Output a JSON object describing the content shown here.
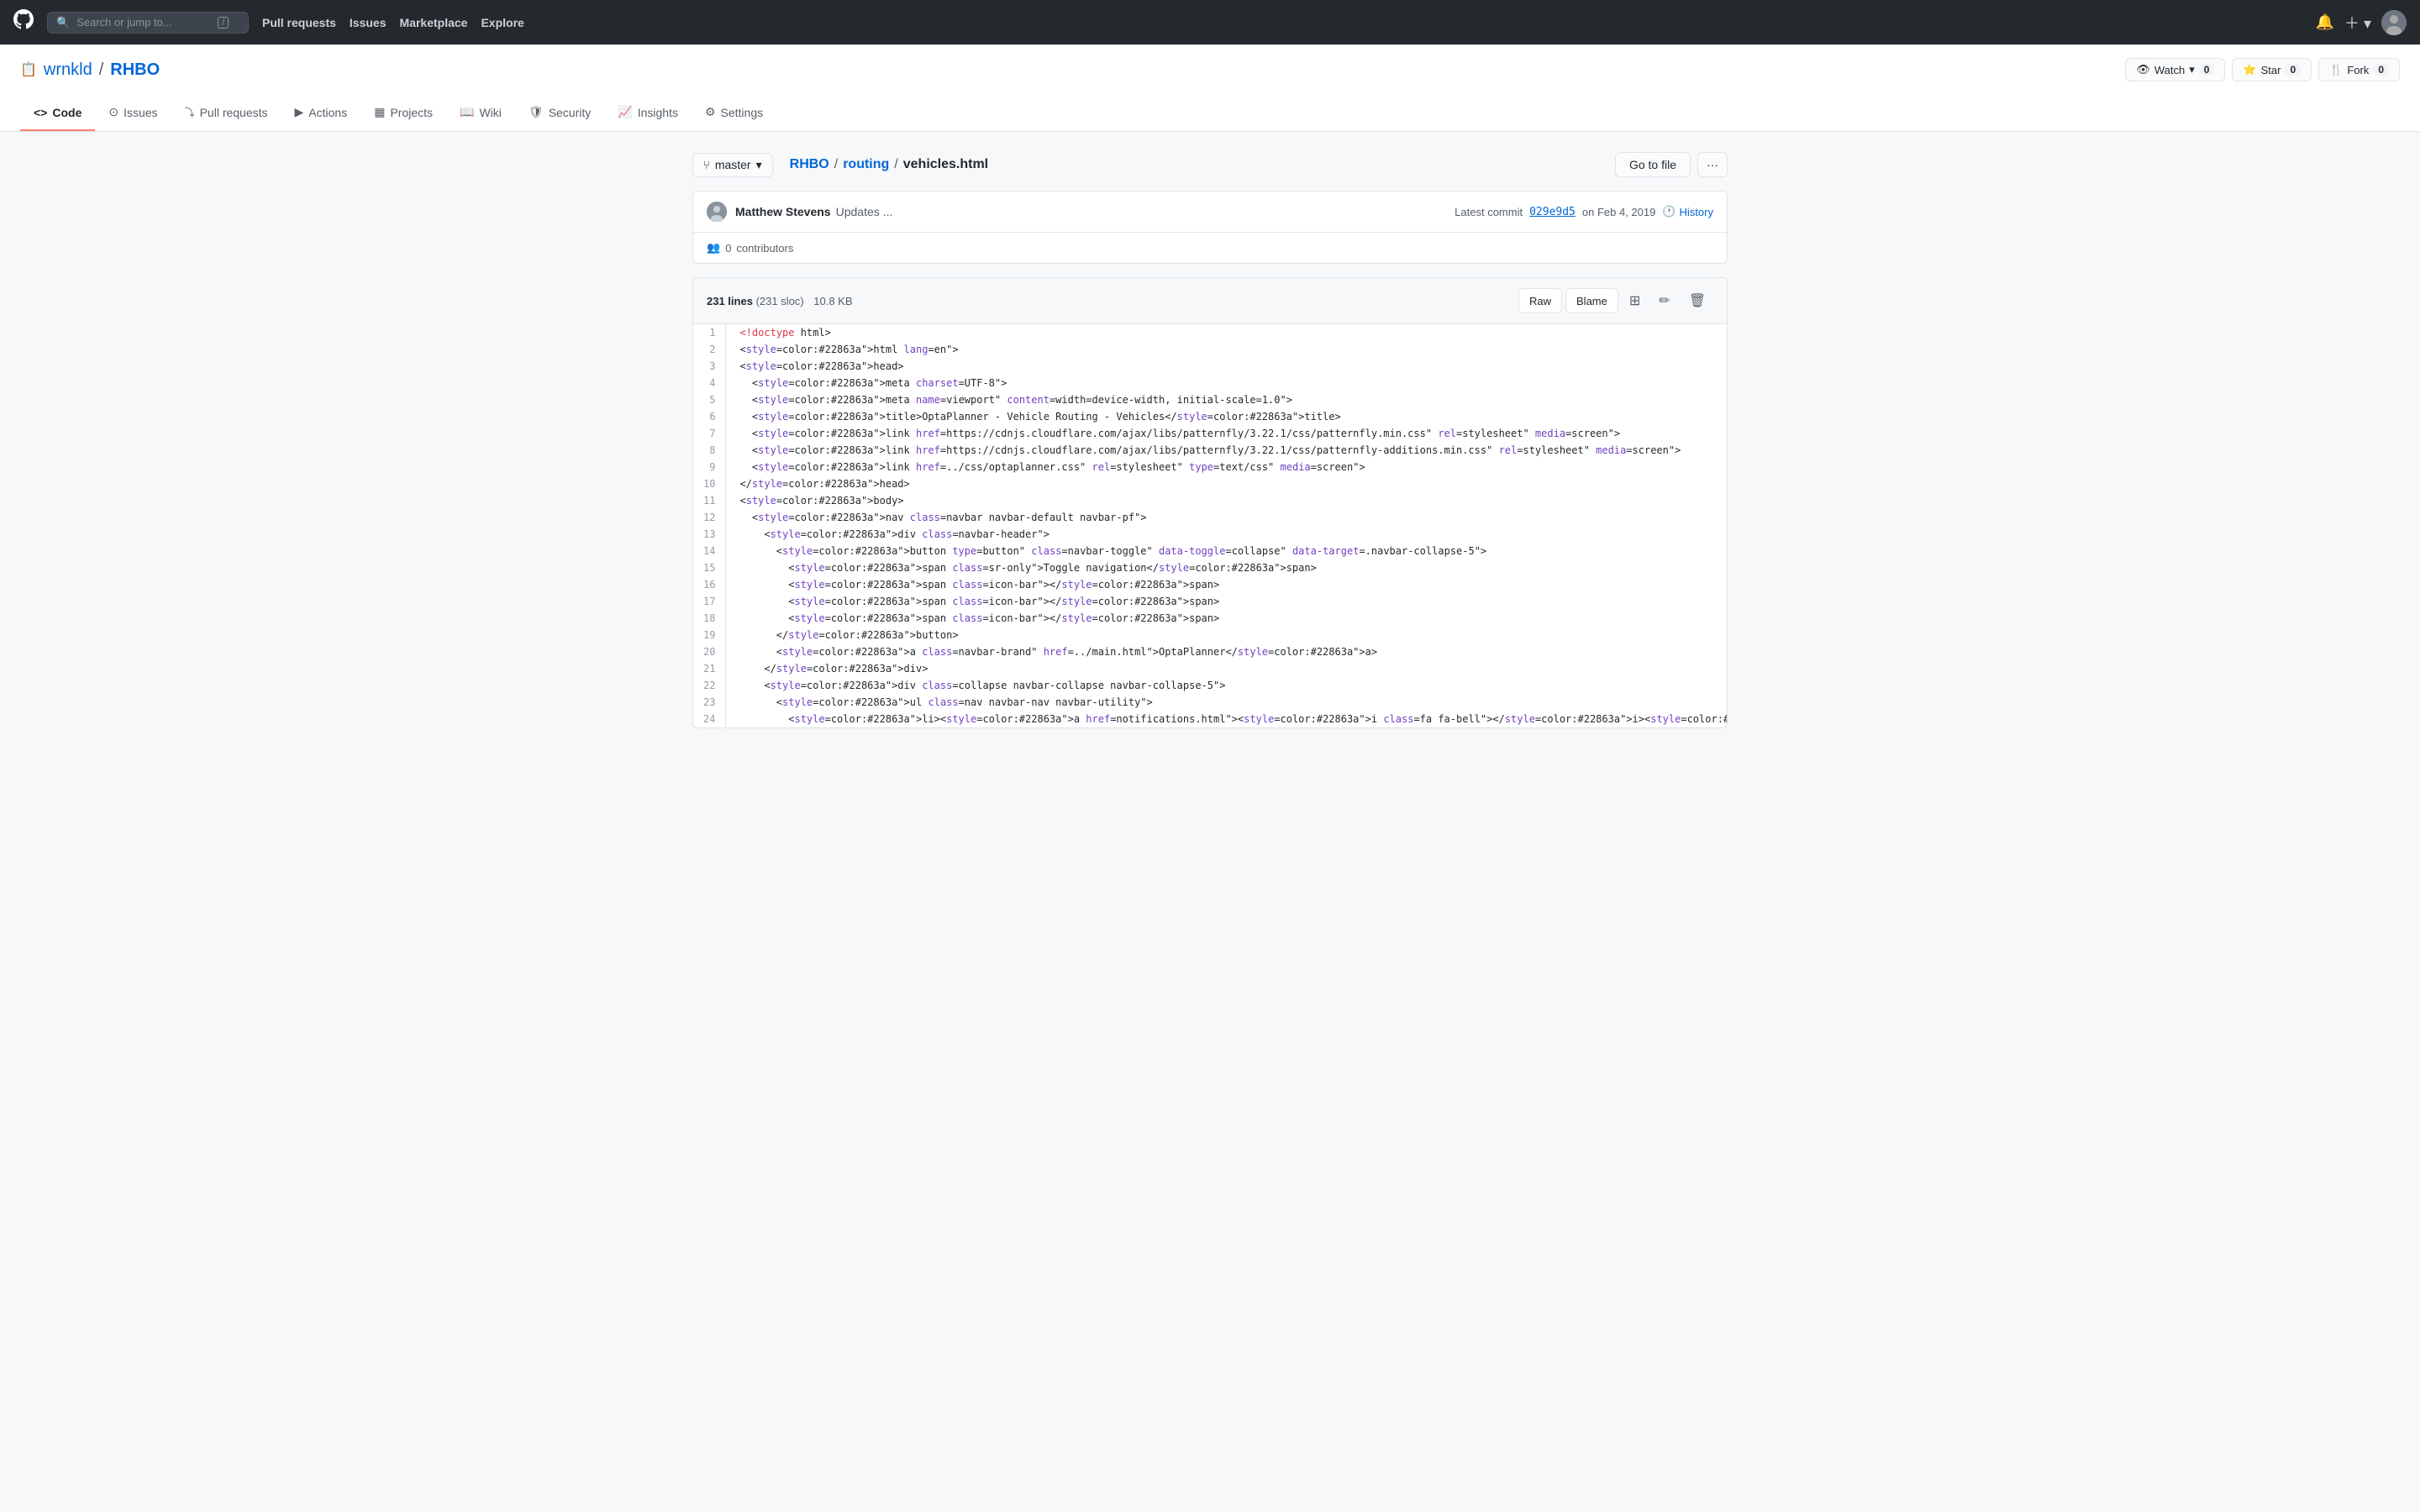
{
  "topnav": {
    "search_placeholder": "Search or jump to...",
    "slash_shortcut": "/",
    "links": [
      "Pull requests",
      "Issues",
      "Marketplace",
      "Explore"
    ],
    "watch_label": "Watch",
    "watch_count": "0",
    "star_label": "Star",
    "star_count": "0",
    "fork_label": "Fork",
    "fork_count": "0"
  },
  "repo": {
    "owner": "wrnkld",
    "name": "RHBO",
    "tabs": [
      {
        "label": "Code",
        "icon": "code"
      },
      {
        "label": "Issues",
        "icon": "issue"
      },
      {
        "label": "Pull requests",
        "icon": "pr"
      },
      {
        "label": "Actions",
        "icon": "action"
      },
      {
        "label": "Projects",
        "icon": "project"
      },
      {
        "label": "Wiki",
        "icon": "wiki"
      },
      {
        "label": "Security",
        "icon": "shield"
      },
      {
        "label": "Insights",
        "icon": "chart"
      },
      {
        "label": "Settings",
        "icon": "gear"
      }
    ],
    "active_tab": "Code"
  },
  "breadcrumb": {
    "branch": "master",
    "parts": [
      "RHBO",
      "routing"
    ],
    "file": "vehicles.html"
  },
  "commit": {
    "author_name": "Matthew Stevens",
    "message": "Updates",
    "dots": "...",
    "latest_commit_label": "Latest commit",
    "hash": "029e9d5",
    "date": "on Feb 4, 2019",
    "history_label": "History"
  },
  "contributors": {
    "icon": "👥",
    "count": "0",
    "label": "contributors"
  },
  "file_viewer": {
    "lines_label": "231 lines",
    "sloc_label": "(231 sloc)",
    "size": "10.8 KB",
    "raw_label": "Raw",
    "blame_label": "Blame"
  },
  "code_lines": [
    {
      "num": 1,
      "content": "<!doctype html>"
    },
    {
      "num": 2,
      "content": "<html lang=\"en\">"
    },
    {
      "num": 3,
      "content": "<head>"
    },
    {
      "num": 4,
      "content": "  <meta charset=\"UTF-8\">"
    },
    {
      "num": 5,
      "content": "  <meta name=\"viewport\" content=\"width=device-width, initial-scale=1.0\">"
    },
    {
      "num": 6,
      "content": "  <title>OptaPlanner - Vehicle Routing - Vehicles</title>"
    },
    {
      "num": 7,
      "content": "  <link href=\"https://cdnjs.cloudflare.com/ajax/libs/patternfly/3.22.1/css/patternfly.min.css\" rel=\"stylesheet\" media=\"screen\">"
    },
    {
      "num": 8,
      "content": "  <link href=\"https://cdnjs.cloudflare.com/ajax/libs/patternfly/3.22.1/css/patternfly-additions.min.css\" rel=\"stylesheet\" media=\"screen\">"
    },
    {
      "num": 9,
      "content": "  <link href=\"../css/optaplanner.css\" rel=\"stylesheet\" type=\"text/css\" media=\"screen\">"
    },
    {
      "num": 10,
      "content": "</head>"
    },
    {
      "num": 11,
      "content": "<body>"
    },
    {
      "num": 12,
      "content": "  <nav class=\"navbar navbar-default navbar-pf\">"
    },
    {
      "num": 13,
      "content": "    <div class=\"navbar-header\">"
    },
    {
      "num": 14,
      "content": "      <button type=\"button\" class=\"navbar-toggle\" data-toggle=\"collapse\" data-target=\".navbar-collapse-5\">"
    },
    {
      "num": 15,
      "content": "        <span class=\"sr-only\">Toggle navigation</span>"
    },
    {
      "num": 16,
      "content": "        <span class=\"icon-bar\"></span>"
    },
    {
      "num": 17,
      "content": "        <span class=\"icon-bar\"></span>"
    },
    {
      "num": 18,
      "content": "        <span class=\"icon-bar\"></span>"
    },
    {
      "num": 19,
      "content": "      </button>"
    },
    {
      "num": 20,
      "content": "      <a class=\"navbar-brand\" href=\"../main.html\">OptaPlanner</a>"
    },
    {
      "num": 21,
      "content": "    </div>"
    },
    {
      "num": 22,
      "content": "    <div class=\"collapse navbar-collapse navbar-collapse-5\">"
    },
    {
      "num": 23,
      "content": "      <ul class=\"nav navbar-nav navbar-utility\">"
    },
    {
      "num": 24,
      "content": "        <li><a href=\"notifications.html\"><i class=\"fa fa-bell\"></i><span class=\"bluedot\"></span></a></li>"
    }
  ],
  "buttons": {
    "go_to_file": "Go to file",
    "more": "···"
  }
}
